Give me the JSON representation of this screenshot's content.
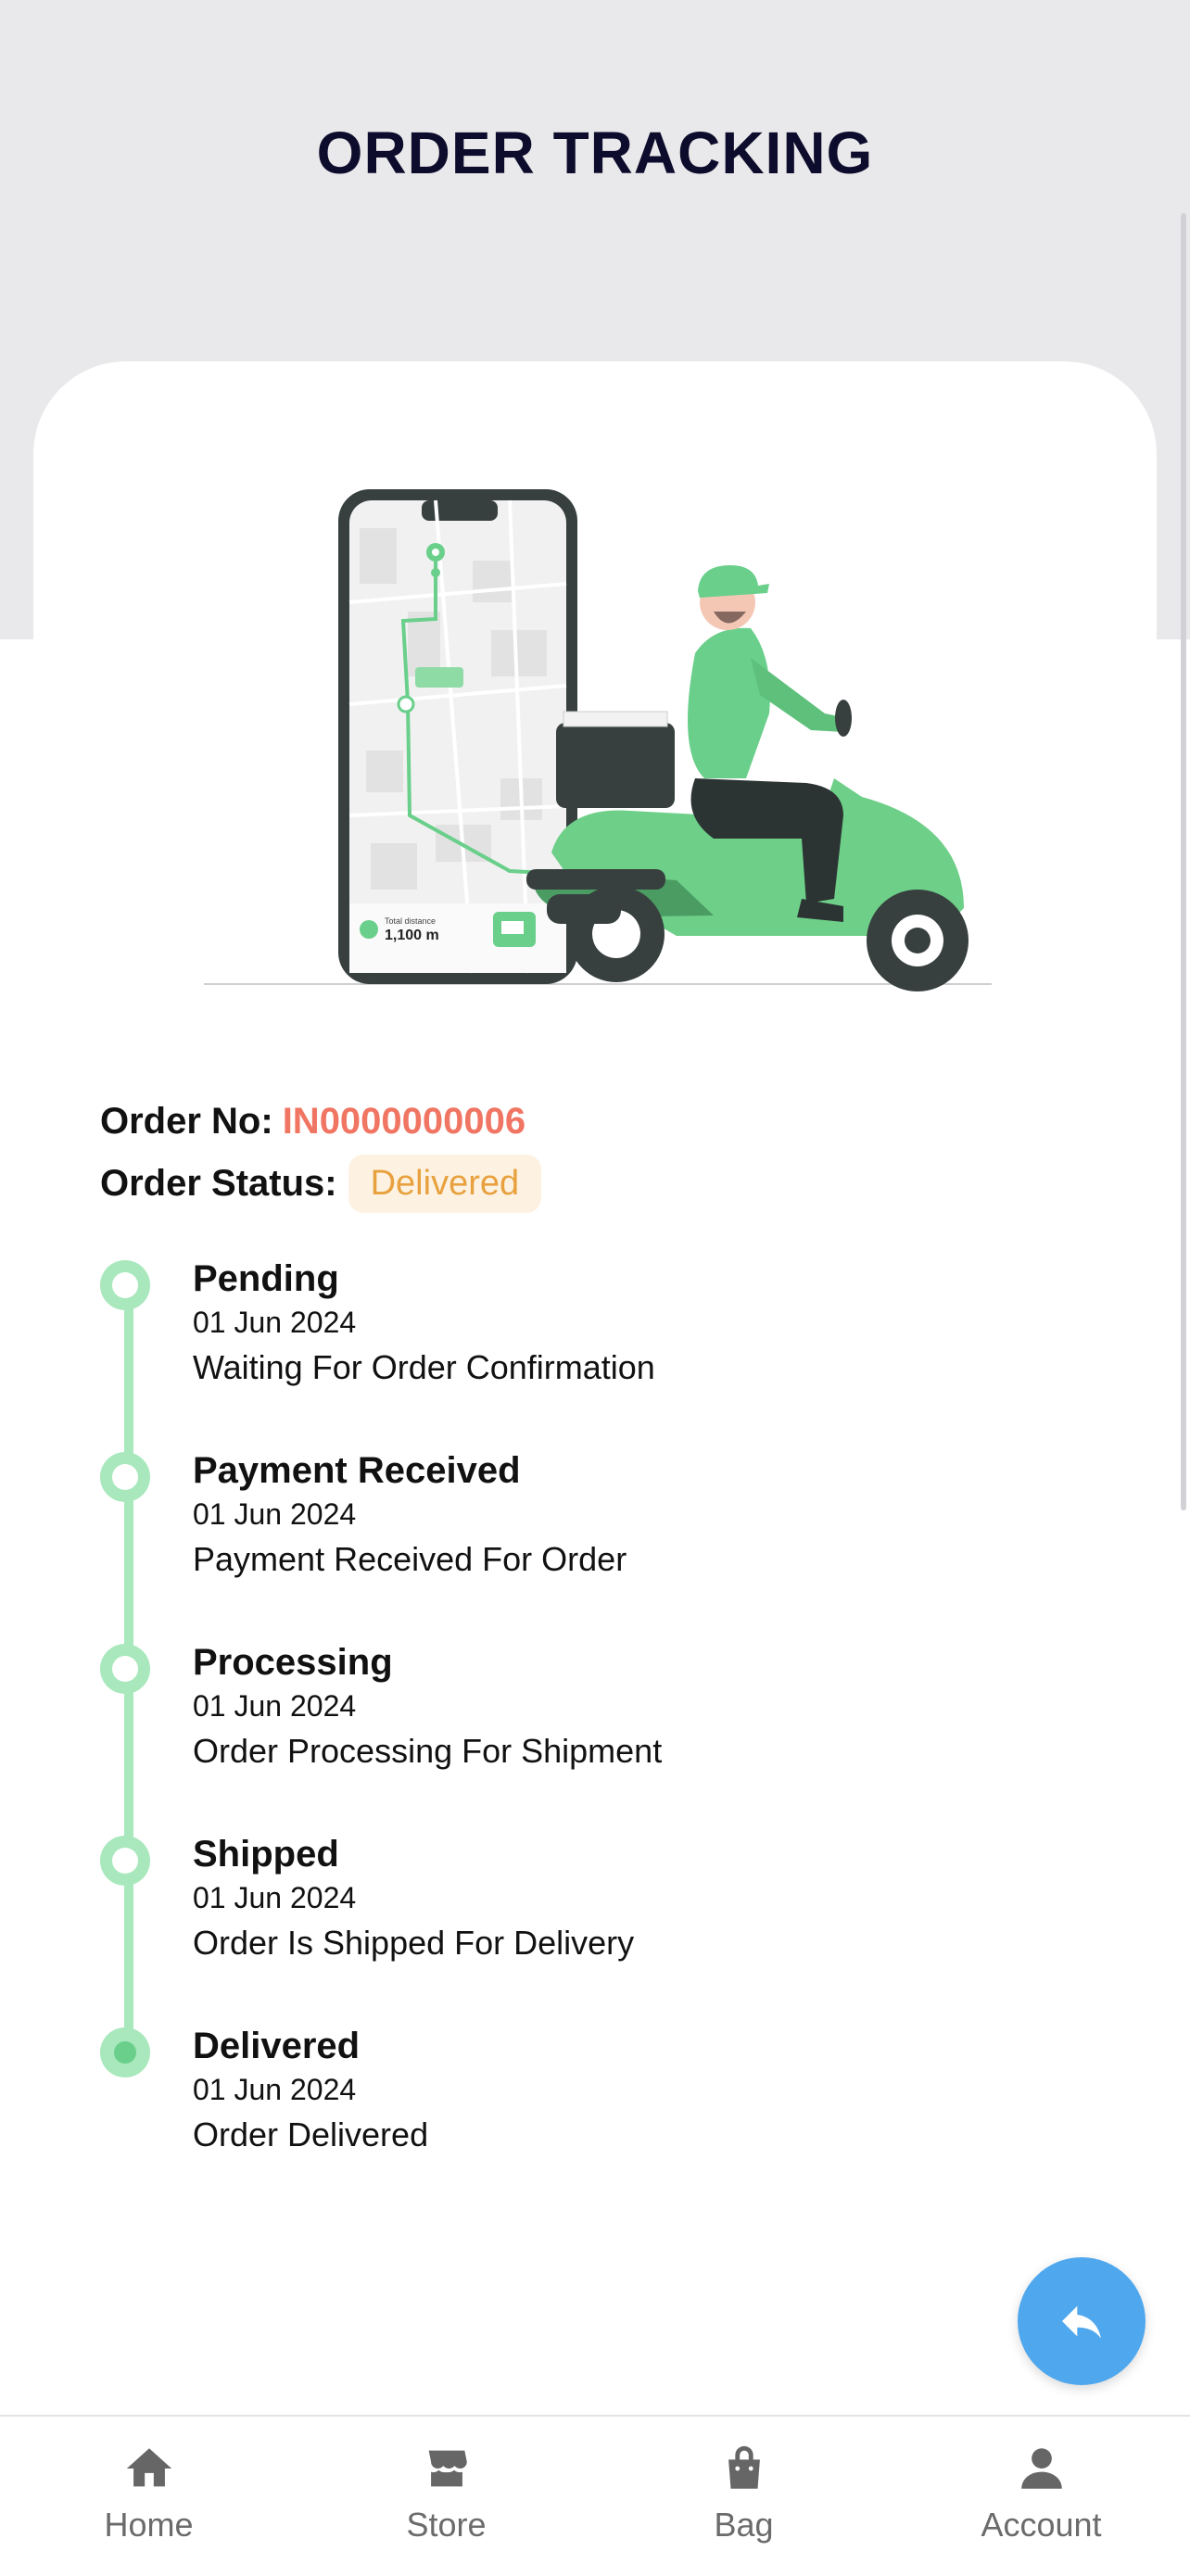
{
  "header": {
    "title": "ORDER TRACKING"
  },
  "order": {
    "number_label": "Order No:",
    "number": "IN0000000006",
    "status_label": "Order Status:",
    "status": "Delivered"
  },
  "hero": {
    "distance_label": "Total distance",
    "distance_value": "1,100 m"
  },
  "timeline": [
    {
      "title": "Pending",
      "date": "01 Jun 2024",
      "desc": "Waiting For Order Confirmation"
    },
    {
      "title": "Payment Received",
      "date": "01 Jun 2024",
      "desc": "Payment Received For Order"
    },
    {
      "title": "Processing",
      "date": "01 Jun 2024",
      "desc": "Order Processing For Shipment"
    },
    {
      "title": "Shipped",
      "date": "01 Jun 2024",
      "desc": "Order Is Shipped For Delivery"
    },
    {
      "title": "Delivered",
      "date": "01 Jun 2024",
      "desc": "Order Delivered"
    }
  ],
  "fab": {
    "icon": "reply-icon"
  },
  "nav": [
    {
      "label": "Home",
      "icon": "home-icon"
    },
    {
      "label": "Store",
      "icon": "store-icon"
    },
    {
      "label": "Bag",
      "icon": "bag-icon"
    },
    {
      "label": "Account",
      "icon": "account-icon"
    }
  ],
  "colors": {
    "accent_green": "#a8e8bc",
    "order_number": "#f07563",
    "status_badge_text": "#e8a13e",
    "fab": "#4fa7ee"
  }
}
